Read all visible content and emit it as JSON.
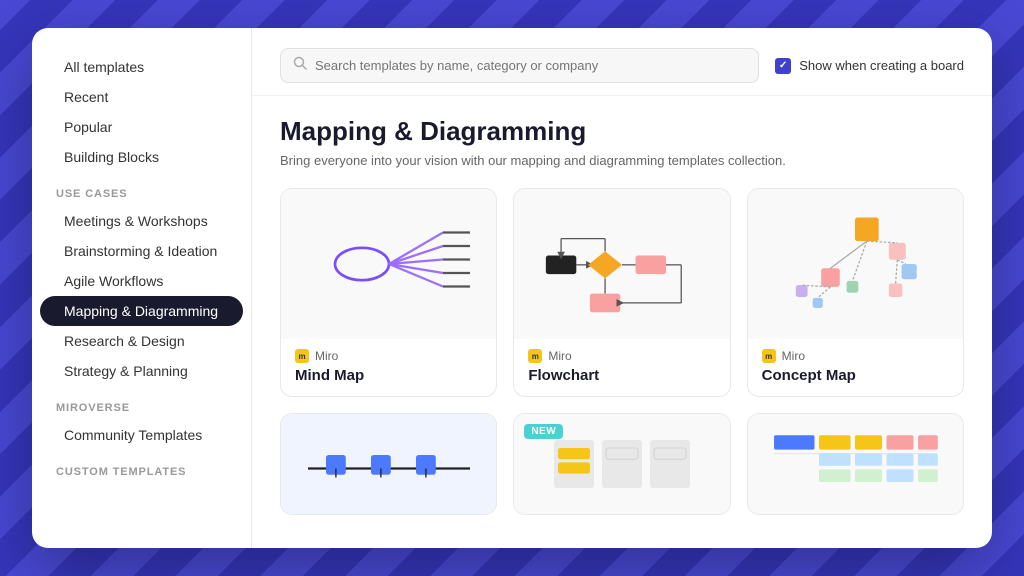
{
  "search": {
    "placeholder": "Search templates by name, category or company"
  },
  "show_when_creating": {
    "label": "Show when creating a board"
  },
  "sidebar": {
    "top_items": [
      {
        "label": "All templates",
        "active": false
      },
      {
        "label": "Recent",
        "active": false
      },
      {
        "label": "Popular",
        "active": false
      },
      {
        "label": "Building Blocks",
        "active": false
      }
    ],
    "use_cases_label": "USE CASES",
    "use_cases": [
      {
        "label": "Meetings & Workshops",
        "active": false
      },
      {
        "label": "Brainstorming & Ideation",
        "active": false
      },
      {
        "label": "Agile Workflows",
        "active": false
      },
      {
        "label": "Mapping & Diagramming",
        "active": true
      },
      {
        "label": "Research & Design",
        "active": false
      },
      {
        "label": "Strategy & Planning",
        "active": false
      }
    ],
    "miroverse_label": "MIROVERSE",
    "miroverse_items": [
      {
        "label": "Community Templates",
        "active": false
      }
    ],
    "custom_label": "CUSTOM TEMPLATES"
  },
  "main": {
    "section_title": "Mapping & Diagramming",
    "section_desc": "Bring everyone into your vision with our mapping and diagramming templates collection.",
    "templates": [
      {
        "author": "Miro",
        "name": "Mind Map",
        "is_new": false,
        "preview_type": "mind_map"
      },
      {
        "author": "Miro",
        "name": "Flowchart",
        "is_new": false,
        "preview_type": "flowchart"
      },
      {
        "author": "Miro",
        "name": "Concept Map",
        "is_new": false,
        "preview_type": "concept_map"
      },
      {
        "author": "",
        "name": "",
        "is_new": false,
        "preview_type": "timeline"
      },
      {
        "author": "",
        "name": "",
        "is_new": true,
        "preview_type": "kanban_new"
      },
      {
        "author": "",
        "name": "",
        "is_new": false,
        "preview_type": "table_grid"
      }
    ]
  }
}
